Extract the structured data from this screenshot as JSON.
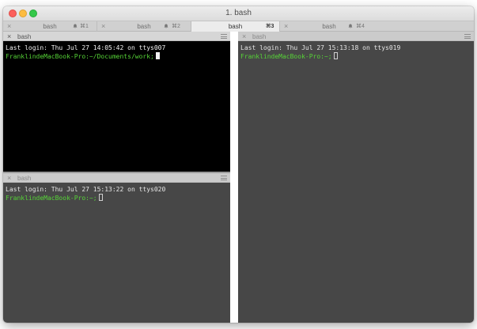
{
  "window": {
    "title": "1. bash"
  },
  "tabs": [
    {
      "label": "bash",
      "shortcut": "⌘1",
      "active": false
    },
    {
      "label": "bash",
      "shortcut": "⌘2",
      "active": false
    },
    {
      "label": "bash",
      "shortcut": "⌘3",
      "active": true
    },
    {
      "label": "bash",
      "shortcut": "⌘4",
      "active": false
    }
  ],
  "panes": {
    "top_left": {
      "title": "bash",
      "line1": "Last login: Thu Jul 27 14:05:42 on ttys007",
      "prompt": "FranklindeMacBook-Pro:~/Documents/work;"
    },
    "bottom_left": {
      "title": "bash",
      "line1": "Last login: Thu Jul 27 15:13:22 on ttys020",
      "prompt": "FranklindeMacBook-Pro:~;"
    },
    "right": {
      "title": "bash",
      "line1": "Last login: Thu Jul 27 15:13:18 on ttys019",
      "prompt": "FranklindeMacBook-Pro:~;"
    }
  },
  "icons": {
    "close": "×",
    "bell": "bell-icon",
    "menu": "hamburger-icon"
  },
  "colors": {
    "prompt_green": "#56d437",
    "term_black": "#000000",
    "term_gray": "#474747",
    "traffic_close": "#fc605c",
    "traffic_min": "#fdbc40",
    "traffic_zoom": "#34c84a"
  }
}
